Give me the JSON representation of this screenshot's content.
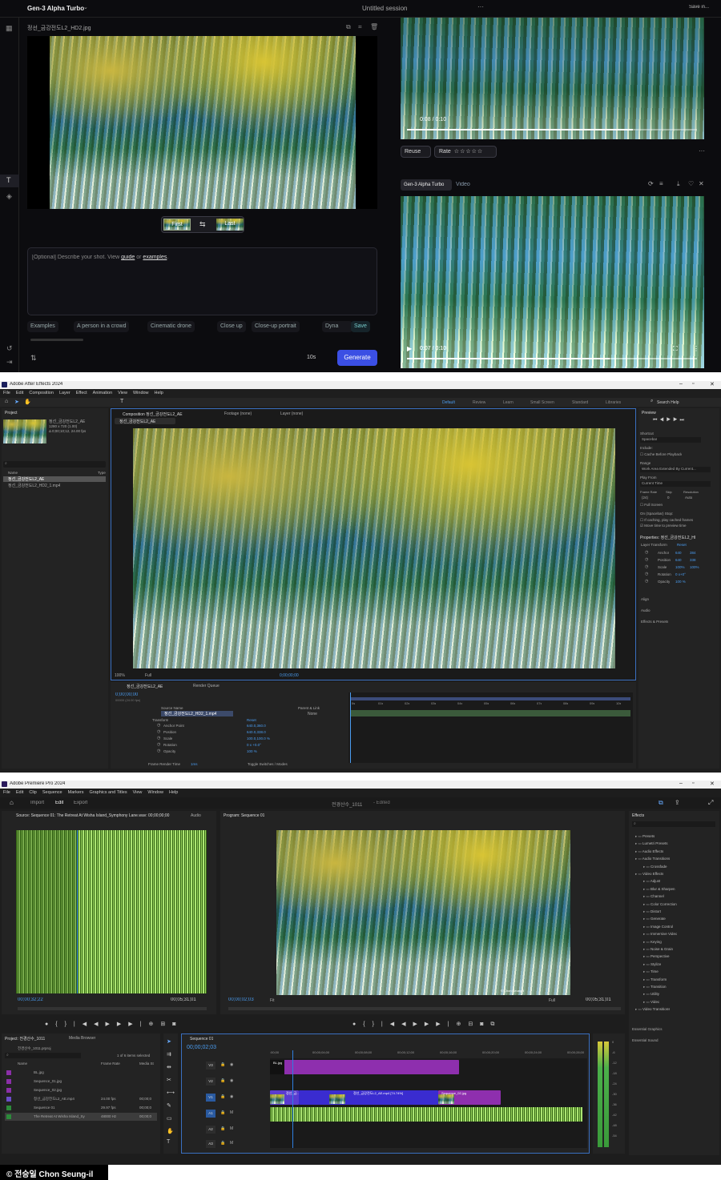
{
  "runway": {
    "model": "Gen-3 Alpha Turbo",
    "session": "Untitled session",
    "save": "Save in...",
    "filename": "정선_금강전도L2_HD2.jpg",
    "first": "First",
    "swap": "⇆",
    "last": "Last",
    "prompt_placeholder_a": "[Optional] Describe your shot. View ",
    "prompt_link1": "guide",
    "prompt_or": " or ",
    "prompt_link2": "examples",
    "prompt_end": ".",
    "chips": [
      "Examples",
      "A person in a crowd",
      "Cinematic drone",
      "Close up",
      "Close-up portrait",
      "Dyna"
    ],
    "chip_save": "Save",
    "duration": "10s",
    "generate": "Generate",
    "video1_time": "0:08 / 0:10",
    "video1_progress": 0.78,
    "reuse": "Reuse",
    "rate": "Rate",
    "tag_model": "Gen-3 Alpha Turbo",
    "tag_video": "Video",
    "video2_time": "0:07 / 0:10",
    "video2_progress": 0.7
  },
  "ae": {
    "title": "Adobe After Effects 2024",
    "menu": [
      "File",
      "Edit",
      "Composition",
      "Layer",
      "Effect",
      "Animation",
      "View",
      "Window",
      "Help"
    ],
    "workspaces": [
      "Default",
      "Review",
      "Learn",
      "Small Screen",
      "Standard",
      "Libraries"
    ],
    "search": "Search Help",
    "project_tab": "Project",
    "comp_tab": "Composition 정선_금강전도L2_AE",
    "footage_tab": "Footage (none)",
    "layer_tab": "Layer (none)",
    "comp_chip": "정선_금강전도L2_AE",
    "thumb_name": "정선_금강전도L2_AE",
    "thumb_info1": "1280 x 720 (1.00)",
    "thumb_info2": "Δ 0;00;10;12, 24.00 fps",
    "proj_col_name": "Name",
    "proj_col_type": "Type",
    "proj_items": [
      "정선_금강전도L2_AE",
      "정선_금강전도L2_HD2_1.mp4"
    ],
    "zoom": "100%",
    "quality": "Full",
    "viewer_time": "0;00;00;00",
    "tl_tab": "정선_금강전도L2_AE",
    "render_queue": "Render Queue",
    "tl_time": "0;00;00;00",
    "tl_fps": "00000 (24.00 fps)",
    "src_col": "Source Name",
    "parent_col": "Parent & Link",
    "layer_name": "정선_금강전도L2_HD2_1.mp4",
    "layer_parent": "None",
    "transform": "Transform",
    "reset": "Reset",
    "props": [
      {
        "n": "Anchor Point",
        "v": "640.0,360.0"
      },
      {
        "n": "Position",
        "v": "640.0,338.0"
      },
      {
        "n": "Scale",
        "v": "100.0,100.0 %"
      },
      {
        "n": "Rotation",
        "v": "0 x +0.0°"
      },
      {
        "n": "Opacity",
        "v": "100 %"
      }
    ],
    "ruler": [
      "0s",
      "01s",
      "02s",
      "03s",
      "04s",
      "05s",
      "06s",
      "07s",
      "08s",
      "09s",
      "10s"
    ],
    "frame_render": "Frame Render Time",
    "frame_render_val": "1ms",
    "toggle": "Toggle Switches / Modes",
    "preview": {
      "tab": "Preview",
      "shortcut_l": "Shortcut",
      "shortcut": "Spacebar",
      "include": "Include:",
      "cache": "Cache Before Playback",
      "range_l": "Range",
      "range": "Work Area Extended By Current...",
      "playfrom_l": "Play From",
      "playfrom": "Current Time",
      "fr_l": "Frame Rate",
      "skip_l": "Skip",
      "res_l": "Resolution",
      "fr": "(24)",
      "skip": "0",
      "res": "Auto",
      "full": "Full Screen",
      "stop": "On (Spacebar) Stop:",
      "if_caching": "If caching, play cached frames",
      "move_time": "Move time to preview time",
      "props_title": "Properties: 정선_금강전도L2_HI",
      "layer_transform": "Layer Transform",
      "reset": "Reset",
      "rows": [
        {
          "n": "Anchor",
          "a": "640",
          "b": "384"
        },
        {
          "n": "Position",
          "a": "640",
          "b": "338"
        },
        {
          "n": "Scale",
          "a": "100%",
          "b": "100%"
        },
        {
          "n": "Rotation",
          "a": "0 x+0°",
          "b": ""
        },
        {
          "n": "Opacity",
          "a": "100 %",
          "b": ""
        }
      ],
      "align": "Align",
      "audio": "Audio",
      "fx": "Effects & Presets"
    }
  },
  "pr": {
    "title": "Adobe Premiere Pro 2024",
    "menu": [
      "File",
      "Edit",
      "Clip",
      "Sequence",
      "Markers",
      "Graphics and Titles",
      "View",
      "Window",
      "Help"
    ],
    "tabs": [
      "Import",
      "Edit",
      "Export"
    ],
    "doc": "전경산수_1011",
    "edited": "- Edited",
    "source_tab": "Source: Sequence 01: The Retreat At Wisha Island_Symphony Lane.wav: 00;00;00;00",
    "audio_tab": "Audio",
    "program_tab": "Program: Sequence 01",
    "src_time": "00;00;32;22",
    "src_dur": "00;05;31;01",
    "prg_time": "00;00;02;03",
    "fit": "Fit",
    "full": "Full",
    "prg_dur": "00;05;31;01",
    "copyright": "© Chon Seung-il",
    "project_tab": "Project: 전경산수_1011",
    "media_browser": "Media Browser",
    "proj_file": "전경산수_1011.prproj",
    "items_sel": "1 of 6 items selected",
    "col_name": "Name",
    "col_fr": "Frame Rate",
    "col_ms": "Media St",
    "items": [
      {
        "n": "BL.jpg",
        "fr": "",
        "ms": "",
        "c": "#8b2fa8"
      },
      {
        "n": "Sequence_01.jpg",
        "fr": "",
        "ms": "",
        "c": "#8b2fa8"
      },
      {
        "n": "Sequence_02.jpg",
        "fr": "",
        "ms": "",
        "c": "#8b2fa8"
      },
      {
        "n": "정선_금강전도L2_AE.mp4",
        "fr": "24.00 fps",
        "ms": "00;00;0",
        "c": "#6a4dc8"
      },
      {
        "n": "Sequence 01",
        "fr": "29.97 fps",
        "ms": "00;00;0",
        "c": "#2c8a3a"
      },
      {
        "n": "The Retreat At Wisha Island_Sy",
        "fr": "48000 Hz",
        "ms": "00;00;0",
        "c": "#2c8a3a"
      }
    ],
    "seq_tab": "Sequence 01",
    "seq_time": "00;00;02;03",
    "ruler": [
      ":00;00",
      "00;00;04;00",
      "00;00;08;00",
      "00;00;12;00",
      "00;00;16;00",
      "00;00;20;00",
      "00;00;24;00",
      "00;00;28;00"
    ],
    "tracks": [
      "V3",
      "V2",
      "V1",
      "A1",
      "A2",
      "A3"
    ],
    "clip_bl": "BL.jpg",
    "clip_v1a": "정선_금...",
    "clip_v1b": "정선_금강전도L2_AE.mp4 [74.74%]",
    "clip_v1c": "Sequence_02.jpg",
    "effects_tab": "Effects",
    "fx_items": [
      "Presets",
      "Lumetri Presets",
      "Audio Effects",
      "Audio Transitions",
      "Crossfade",
      "Video Effects",
      "Adjust",
      "Blur & Sharpen",
      "Channel",
      "Color Correction",
      "Distort",
      "Generate",
      "Image Control",
      "Immersive Video",
      "Keying",
      "Noise & Grain",
      "Perspective",
      "Stylize",
      "Time",
      "Transform",
      "Transition",
      "Utility",
      "Video",
      "Video Transitions"
    ],
    "essential_graphics": "Essential Graphics",
    "essential_sound": "Essential Sound",
    "meter": [
      "0",
      "-6",
      "-12",
      "-18",
      "-24",
      "-30",
      "-36",
      "-42",
      "-48",
      "-54"
    ]
  },
  "credit": "© 전승일 Chon Seung-il"
}
